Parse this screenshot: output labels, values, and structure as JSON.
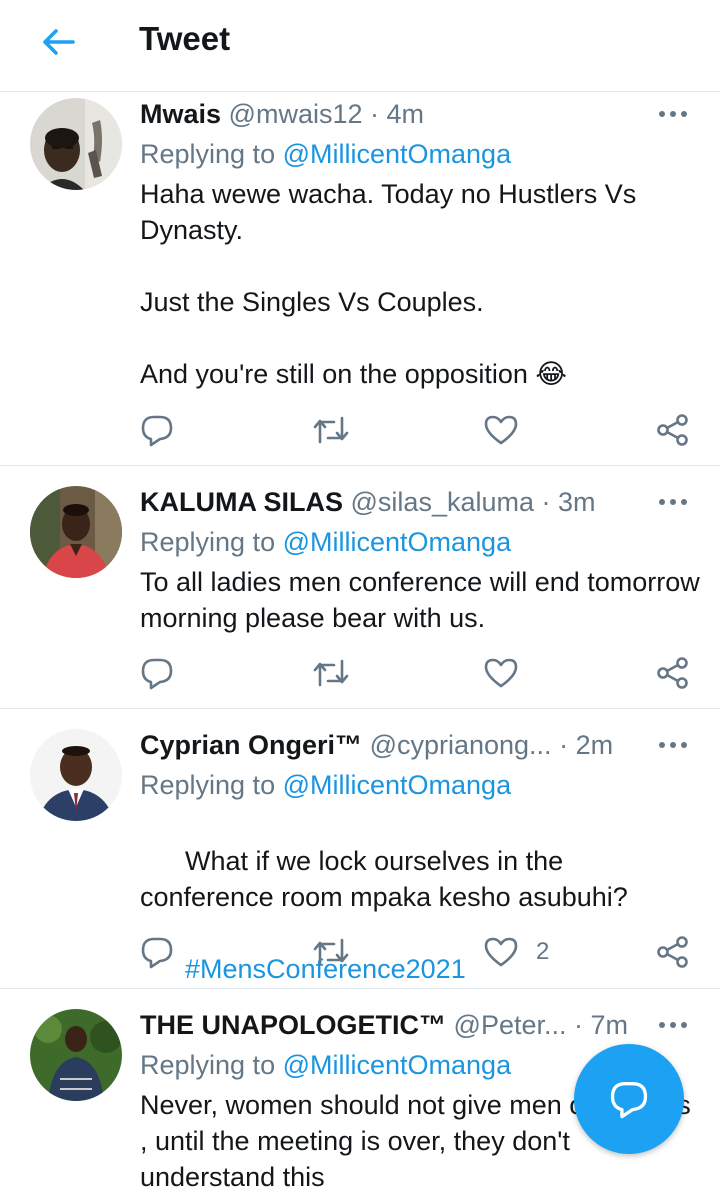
{
  "header": {
    "title": "Tweet",
    "back_icon": "arrow-left-icon"
  },
  "colors": {
    "accent": "#1da1f2",
    "link": "#1b95e0",
    "muted": "#657786",
    "text": "#14171a",
    "border": "#e1e8ed"
  },
  "tweets": [
    {
      "name": "Mwais",
      "handle": "@mwais12",
      "separator": " · ",
      "time": "4m",
      "replying_prefix": "Replying to ",
      "replying_to": "@MillicentOmanga",
      "text": "Haha wewe wacha. Today no Hustlers Vs Dynasty.\n\nJust the Singles Vs Couples.\n\nAnd you're still on the opposition 😂",
      "likes": ""
    },
    {
      "name": "KALUMA SILAS",
      "handle": "@silas_kaluma",
      "separator": " · ",
      "time": "3m",
      "replying_prefix": "Replying to ",
      "replying_to": "@MillicentOmanga",
      "text": "To all ladies men conference will end tomorrow morning please bear with us.",
      "likes": ""
    },
    {
      "name": "Cyprian Ongeri™",
      "handle": "@cyprianong...",
      "separator": " · ",
      "time": "2m",
      "replying_prefix": "Replying to ",
      "replying_to": "@MillicentOmanga",
      "text": "What if we lock ourselves in the conference room mpaka kesho asubuhi?",
      "hashtag": "#MensConference2021",
      "likes": "2"
    },
    {
      "name": "THE UNAPOLOGETIC™",
      "handle": "@Peter...",
      "separator": " · ",
      "time": "7m",
      "replying_prefix": "Replying to ",
      "replying_to": "@MillicentOmanga",
      "text": "Never, women should not give men conditions , until the meeting is over, they don't understand this",
      "likes": ""
    }
  ],
  "fab": {
    "icon": "compose-reply-icon"
  }
}
